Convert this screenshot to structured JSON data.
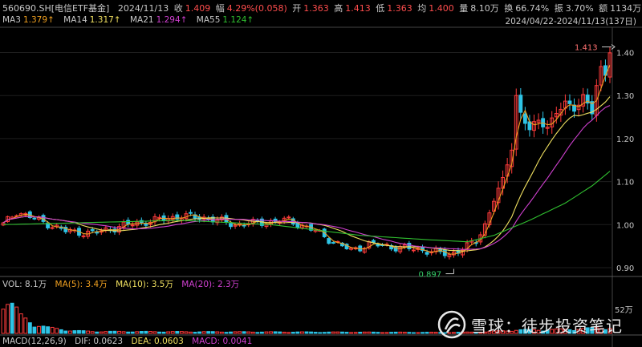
{
  "header": {
    "symbol": "560690.SH[电信ETF基金]",
    "date": "2024/11/13",
    "close_label": "收",
    "close": "1.409",
    "change_label": "幅",
    "change": "4.29%(0.058)",
    "open_label": "开",
    "open": "1.363",
    "high_label": "高",
    "high": "1.413",
    "low_label": "低",
    "low": "1.363",
    "avg_label": "均",
    "avg": "1.400",
    "volume_label": "量",
    "volume": "8.10万",
    "turnover_label": "换",
    "turnover": "66.74%",
    "amplitude_label": "振",
    "amplitude": "3.70%",
    "amount_label": "额",
    "amount": "1134万"
  },
  "ma_line": {
    "ma3_label": "MA3",
    "ma3": "1.379↑",
    "ma14_label": "MA14",
    "ma14": "1.317↑",
    "ma21_label": "MA21",
    "ma21": "1.294↑",
    "ma55_label": "MA55",
    "ma55": "1.124↑",
    "range": "2024/04/22-2024/11/13(137日)"
  },
  "vol_line": {
    "vol": "VOL: 8.1万",
    "ma5": "MA(5): 3.4万",
    "ma10": "MA(10): 3.5万",
    "ma20": "MA(20): 2.3万",
    "axis": "52万"
  },
  "macd_line": {
    "label": "MACD(12,26,9)",
    "dif": "DIF: 0.0623",
    "dea": "DEA: 0.0603",
    "macd": "MACD: 0.0041"
  },
  "watermark": {
    "text": "雪球：徒步投资笔记"
  },
  "colors": {
    "up": "#ff3b3b",
    "down": "#2ec4e6",
    "ma3": "#f0a020",
    "ma14": "#f0e060",
    "ma21": "#d040d0",
    "ma55": "#30c030"
  },
  "chart_data": {
    "type": "candlestick",
    "y_ticks": [
      1.4,
      1.3,
      1.2,
      1.1,
      1.0,
      0.9
    ],
    "y_tick_labels": [
      "1.40",
      "1.30",
      "1.20",
      "1.10",
      "1.00",
      "0.90"
    ],
    "ylim": [
      0.885,
      1.455
    ],
    "n_days": 137,
    "annotations": [
      {
        "label": "1.413",
        "value": 1.413,
        "day": 136
      },
      {
        "label": "0.897",
        "value": 0.897,
        "day": 101
      }
    ],
    "close_path": [
      [
        0,
        1.0
      ],
      [
        3,
        1.03
      ],
      [
        8,
        1.01
      ],
      [
        14,
        0.985
      ],
      [
        20,
        0.98
      ],
      [
        28,
        1.0
      ],
      [
        34,
        1.01
      ],
      [
        40,
        1.02
      ],
      [
        46,
        1.015
      ],
      [
        52,
        1.0
      ],
      [
        58,
        1.005
      ],
      [
        64,
        1.01
      ],
      [
        70,
        0.985
      ],
      [
        74,
        0.96
      ],
      [
        78,
        0.94
      ],
      [
        82,
        0.955
      ],
      [
        86,
        0.95
      ],
      [
        90,
        0.945
      ],
      [
        95,
        0.94
      ],
      [
        100,
        0.93
      ],
      [
        104,
        0.95
      ],
      [
        106,
        0.96
      ],
      [
        108,
        1.0
      ],
      [
        110,
        1.06
      ],
      [
        112,
        1.1
      ],
      [
        114,
        1.18
      ],
      [
        115,
        1.3
      ],
      [
        116,
        1.26
      ],
      [
        118,
        1.22
      ],
      [
        120,
        1.24
      ],
      [
        122,
        1.23
      ],
      [
        124,
        1.26
      ],
      [
        126,
        1.28
      ],
      [
        128,
        1.27
      ],
      [
        130,
        1.3
      ],
      [
        132,
        1.26
      ],
      [
        133,
        1.32
      ],
      [
        134,
        1.36
      ],
      [
        135,
        1.35
      ],
      [
        136,
        1.409
      ]
    ],
    "ma55_path": [
      [
        0,
        1.0
      ],
      [
        20,
        1.005
      ],
      [
        40,
        1.01
      ],
      [
        60,
        1.0
      ],
      [
        80,
        0.975
      ],
      [
        95,
        0.965
      ],
      [
        104,
        0.96
      ],
      [
        110,
        0.975
      ],
      [
        118,
        1.01
      ],
      [
        126,
        1.05
      ],
      [
        132,
        1.09
      ],
      [
        136,
        1.124
      ]
    ],
    "volume_profile": [
      [
        0,
        0.8
      ],
      [
        2,
        0.6
      ],
      [
        4,
        0.35
      ],
      [
        7,
        0.2
      ],
      [
        10,
        0.12
      ],
      [
        15,
        0.06
      ],
      [
        20,
        0.04
      ],
      [
        60,
        0.03
      ],
      [
        100,
        0.02
      ],
      [
        108,
        0.03
      ],
      [
        115,
        0.07
      ],
      [
        125,
        0.08
      ],
      [
        136,
        0.12
      ]
    ]
  }
}
